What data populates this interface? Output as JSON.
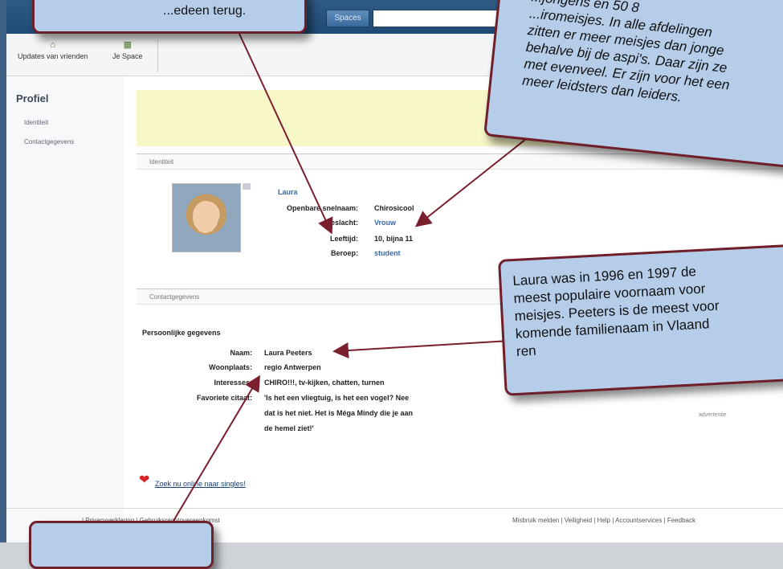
{
  "header": {
    "spaces_button": "Spaces"
  },
  "tabs": [
    {
      "label": "Updates van vrienden",
      "icon": "home-icon"
    },
    {
      "label": "Je Space",
      "icon": "space-icon"
    }
  ],
  "sidebar": {
    "title": "Profiel",
    "items": [
      {
        "label": "Identiteit"
      },
      {
        "label": "Contactgegevens"
      }
    ]
  },
  "identity": {
    "section_title": "Identiteit",
    "name": "Laura",
    "rows": [
      {
        "label": "Openbare snelnaam:",
        "value": "Chirosicool"
      },
      {
        "label": "Geslacht:",
        "value": "Vrouw"
      },
      {
        "label": "Leeftijd:",
        "value": "10, bijna 11"
      },
      {
        "label": "Beroep:",
        "value": "student"
      }
    ]
  },
  "contact": {
    "section_title": "Contactgegevens",
    "subheading": "Persoonlijke gegevens",
    "rows": [
      {
        "label": "Naam:",
        "value": "Laura Peeters"
      },
      {
        "label": "Woonplaats:",
        "value": "regio Antwerpen"
      },
      {
        "label": "Interesses:",
        "value": "CHIRO!!!, tv-kijken, chatten, turnen"
      },
      {
        "label": "Favoriete citaat:",
        "value": "'Is het een vliegtuig, is het een vogel? Nee"
      },
      {
        "label": "",
        "value": "dat is het niet. Het is Méga Mindy die je aan"
      },
      {
        "label": "",
        "value": "de hemel ziet!'"
      }
    ]
  },
  "ad_label": "advertentie",
  "singles_link": "Zoek nu online naar singles!",
  "footer": {
    "left": "| Privacyverklaring | Gebruiksrechtovereenkomst",
    "right": "Misbruik melden | Veiligheid | Help | Accountservices | Feedback"
  },
  "callouts": {
    "top_left": "...edeen terug.",
    "top_right": "...jongens en 50 8\n...iromeisjes.  In alle afdelingen\nzitten er meer meisjes dan jonge\nbehalve bij de aspi's.  Daar zijn ze\nmet evenveel.  Er zijn voor het een\nmeer leidsters dan leiders.",
    "mid_right": "Laura was in 1996 en 1997 de\nmeest populaire voornaam voor\nmeisjes.  Peeters is de meest voor\nkomende familienaam in Vlaand\nren"
  },
  "colors": {
    "header_blue": "#2f5a85",
    "callout_fill": "#b5cde8",
    "callout_border": "#6e1f2a",
    "link_blue": "#3b67a3"
  }
}
